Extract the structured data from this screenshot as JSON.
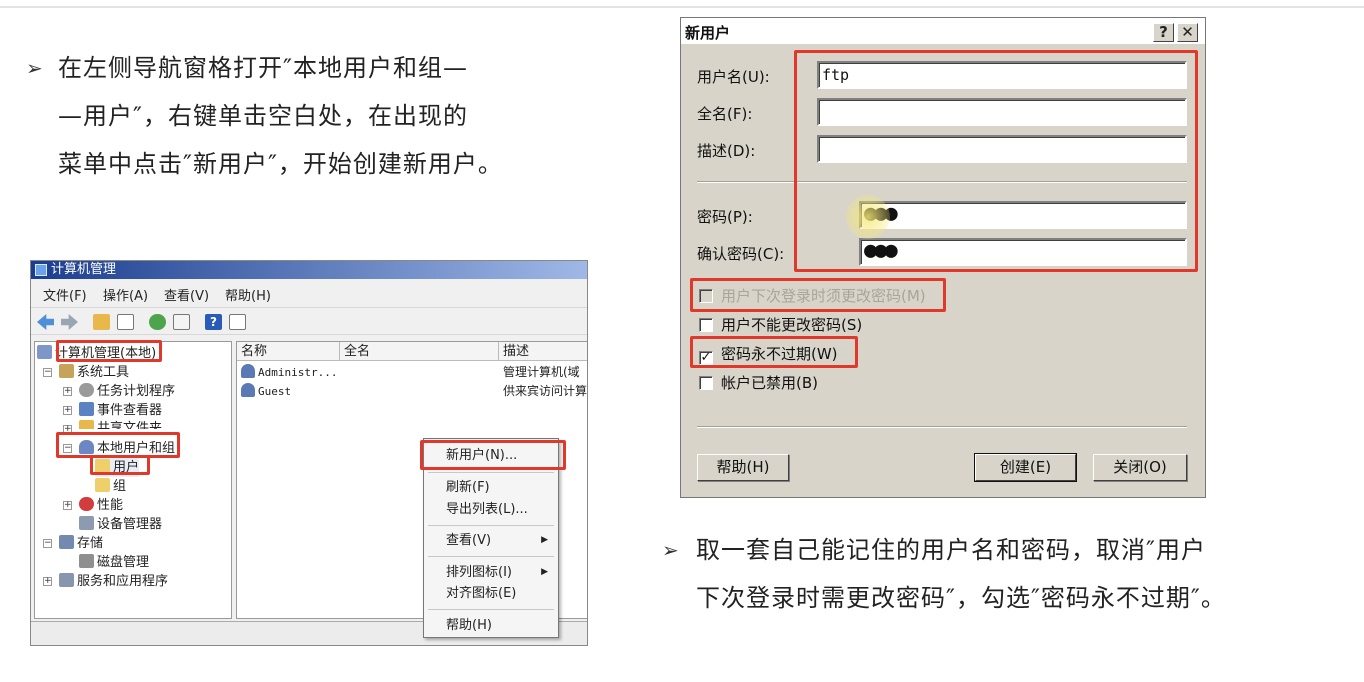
{
  "slide": {
    "instruction_1": {
      "marker": "➢",
      "lines": [
        "在左侧导航窗格打开″本地用户和组—",
        "—用户″，右键单击空白处，在出现的",
        "菜单中点击″新用户″，开始创建新用户。"
      ]
    },
    "instruction_2": {
      "marker": "➢",
      "lines": [
        "取一套自己能记住的用户名和密码，取消″用户",
        "下次登录时需更改密码″，勾选″密码永不过期″。"
      ]
    },
    "highlight_color": "#e0392b"
  },
  "computer_management": {
    "title": "计算机管理",
    "menu": [
      "文件(F)",
      "操作(A)",
      "查看(V)",
      "帮助(H)"
    ],
    "toolbar_icons": [
      "back-arrow-icon",
      "forward-arrow-icon",
      "up-folder-icon",
      "show-hide-tree-icon",
      "refresh-icon",
      "export-list-icon",
      "help-icon",
      "properties-icon"
    ],
    "tree": {
      "root": "计算机管理(本地)",
      "system_tools": "系统工具",
      "task_scheduler": "任务计划程序",
      "event_viewer": "事件查看器",
      "shared_folders": "共享文件夹",
      "local_users_groups": "本地用户和组",
      "users": "用户",
      "groups": "组",
      "performance": "性能",
      "device_manager": "设备管理器",
      "storage": "存储",
      "disk_management": "磁盘管理",
      "services_apps": "服务和应用程序"
    },
    "list": {
      "columns": [
        "名称",
        "全名",
        "描述"
      ],
      "rows": [
        {
          "name": "Administr...",
          "fullname": "",
          "desc": "管理计算机(域"
        },
        {
          "name": "Guest",
          "fullname": "",
          "desc": "供来宾访问计算"
        }
      ]
    },
    "context_menu": {
      "new_user": "新用户(N)...",
      "refresh": "刷新(F)",
      "export_list": "导出列表(L)...",
      "view": "查看(V)",
      "arrange_icons": "排列图标(I)",
      "line_up_icons": "对齐图标(E)",
      "help": "帮助(H)"
    }
  },
  "new_user_dialog": {
    "title": "新用户",
    "help_glyph": "?",
    "close_glyph": "✕",
    "username_label": "用户名(U):",
    "username_value": "ftp",
    "fullname_label": "全名(F):",
    "fullname_value": "",
    "description_label": "描述(D):",
    "description_value": "",
    "password_label": "密码(P):",
    "password_mask": "●●●",
    "confirm_label": "确认密码(C):",
    "confirm_mask": "●●●",
    "checkboxes": [
      {
        "label": "用户下次登录时须更改密码(M)",
        "checked": false,
        "disabled": true
      },
      {
        "label": "用户不能更改密码(S)",
        "checked": false,
        "disabled": false
      },
      {
        "label": "密码永不过期(W)",
        "checked": true,
        "disabled": false
      },
      {
        "label": "帐户已禁用(B)",
        "checked": false,
        "disabled": false
      }
    ],
    "check_glyph": "✓",
    "help_button": "帮助(H)",
    "create_button": "创建(E)",
    "close_button": "关闭(O)"
  }
}
